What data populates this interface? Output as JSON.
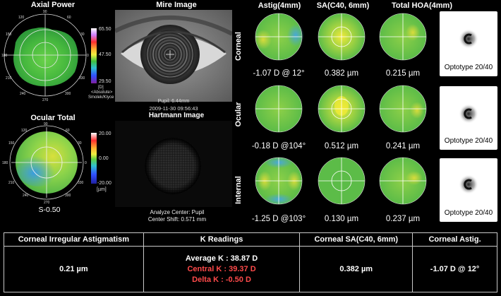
{
  "axial_power": {
    "title": "Axial Power",
    "scale": [
      "65.50",
      "47.50",
      "29.50"
    ],
    "scale_note_1": "[D]",
    "scale_note_2": "<Absolute>",
    "scale_note_3": "Smolek/Klyce",
    "deg_labels": [
      "90",
      "60",
      "30",
      "0",
      "330",
      "300",
      "270",
      "240",
      "210",
      "180",
      "150",
      "120"
    ]
  },
  "mire_image": {
    "title": "Mire Image",
    "pupil": "Pupil: 6.44mm",
    "datetime": "2009-11-30 09:56:43"
  },
  "hartmann_image": {
    "title": "Hartmann Image",
    "analyze_center": "Analyze Center: Pupil",
    "center_shift": "Center Shift:   0.571 mm"
  },
  "ocular_total": {
    "title": "Ocular Total",
    "scale": [
      "20.00",
      "0.00",
      "-20.00"
    ],
    "scale_unit": "[µm]",
    "value": "S-0.50",
    "deg_labels": [
      "90",
      "60",
      "30",
      "0",
      "330",
      "300",
      "270",
      "240",
      "210",
      "180",
      "150",
      "120"
    ]
  },
  "columns": [
    "Astig(4mm)",
    "SA(C40, 6mm)",
    "Total HOA(4mm)"
  ],
  "rows": [
    {
      "label": "Corneal",
      "values": [
        "-1.07 D @ 12°",
        "0.382 µm",
        "0.215 µm"
      ],
      "optotype": "Optotype 20/40"
    },
    {
      "label": "Ocular",
      "values": [
        "-0.18 D @104°",
        "0.512 µm",
        "0.241 µm"
      ],
      "optotype": "Optotype 20/40"
    },
    {
      "label": "Internal",
      "values": [
        "-1.25 D @103°",
        "0.130 µm",
        "0.237 µm"
      ],
      "optotype": "Optotype 20/40"
    }
  ],
  "table": {
    "headers": [
      "Corneal Irregular Astigmatism",
      "K Readings",
      "Corneal SA(C40, 6mm)",
      "Corneal Astig."
    ],
    "irregular_astig": "0.21 µm",
    "average_k": "Average K : 38.87 D",
    "central_k": "Central K : 39.37 D",
    "delta_k": "Delta K : -0.50 D",
    "corneal_sa": "0.382 µm",
    "corneal_astig": "-1.07 D @ 12°"
  },
  "colors": {
    "green_value": "#7bdf58",
    "red_value": "#ff4a4a",
    "map_green": "#5fc84a",
    "map_yellow": "#d8e03c",
    "map_cyan": "#48b4d8"
  }
}
